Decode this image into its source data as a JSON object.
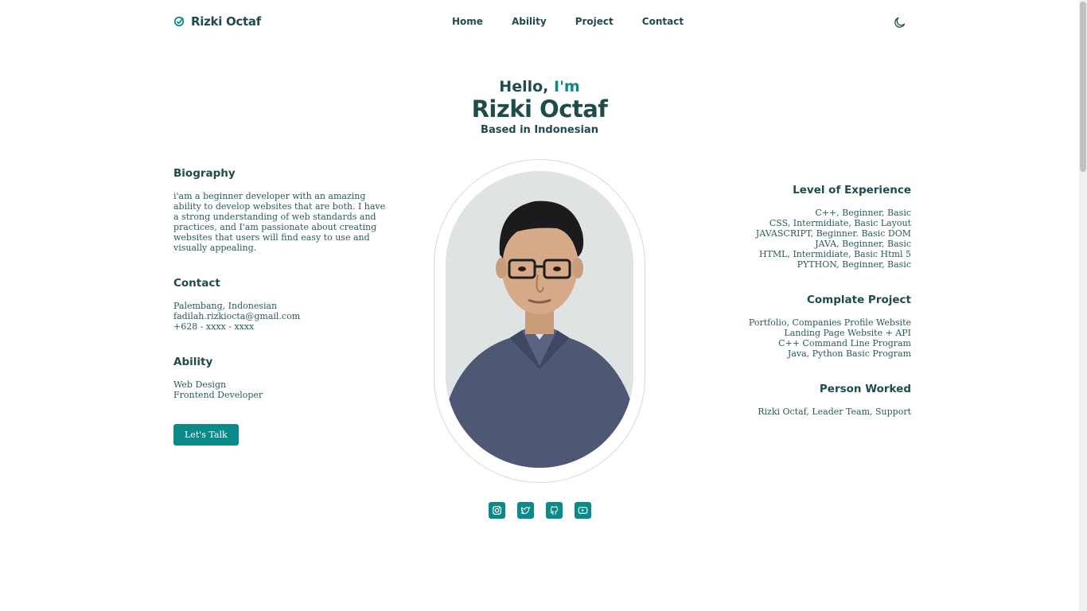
{
  "header": {
    "logo_text": "Rizki Octaf",
    "nav": [
      "Home",
      "Ability",
      "Project",
      "Contact"
    ],
    "theme_icon": "moon-icon"
  },
  "hero": {
    "hello": "Hello,",
    "im": "I'm",
    "name": "Rizki Octaf",
    "based": "Based in Indonesian"
  },
  "biography": {
    "title": "Biography",
    "text": "i'am a beginner developer with an amazing ability to develop websites that are both. I have a strong understanding of web standards and practices, and I'am passionate about creating websites that users will find easy to use and visually appealing."
  },
  "contact": {
    "title": "Contact",
    "location": "Palembang, Indonesian",
    "email": "fadilah.rizkiocta@gmail.com",
    "phone": "+628 - xxxx - xxxx"
  },
  "ability": {
    "title": "Ability",
    "items": [
      "Web Design",
      "Frontend Developer"
    ]
  },
  "cta": {
    "label": "Let's Talk"
  },
  "experience": {
    "title": "Level of Experience",
    "items": [
      "C++, Beginner, Basic",
      "CSS, Intermidiate, Basic Layout",
      "JAVASCRIPT, Beginner. Basic DOM",
      "JAVA, Beginner, Basic",
      "HTML, Intermidiate, Basic Html 5",
      "PYTHON, Beginner, Basic"
    ]
  },
  "projects": {
    "title": "Complate Project",
    "items": [
      "Portfolio, Companies Profile Website",
      "Landing Page Website + API",
      "C++ Command Line Program",
      "Java, Python Basic Program"
    ]
  },
  "worked": {
    "title": "Person Worked",
    "text": "Rizki Octaf, Leader Team, Support"
  },
  "social": [
    "instagram-icon",
    "twitter-icon",
    "github-icon",
    "youtube-icon"
  ],
  "colors": {
    "accent": "#0b8a8a",
    "text": "#1f4b4b"
  }
}
